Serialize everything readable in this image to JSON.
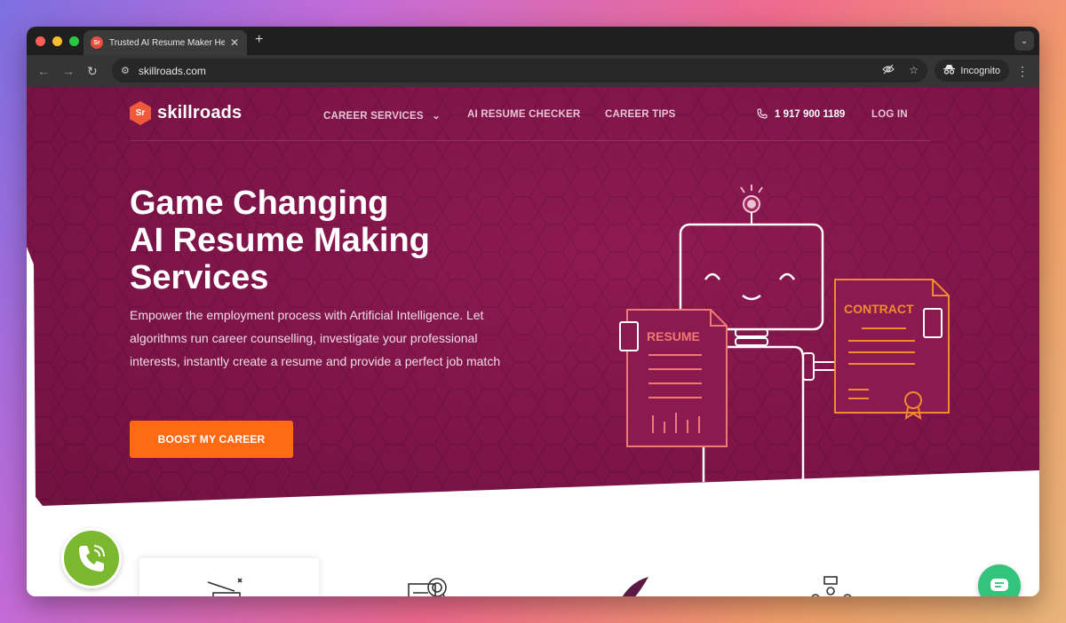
{
  "browser": {
    "tab_title": "Trusted AI Resume Maker Help",
    "tab_favicon_text": "Sr",
    "new_tab_label": "+",
    "url": "skillroads.com",
    "incognito_label": "Incognito"
  },
  "site": {
    "logo_mark": "Sr",
    "logo_text": "skillroads",
    "nav": {
      "career_services": "CAREER SERVICES",
      "ai_resume_checker": "AI RESUME CHECKER",
      "career_tips": "CAREER TIPS",
      "phone": "1 917 900 1189",
      "login": "LOG IN"
    },
    "hero": {
      "title_line1": "Game Changing",
      "title_line2": "AI Resume Making",
      "title_line3": "Services",
      "subtitle": "Empower the employment process with Artificial Intelligence. Let algorithms run career counselling, investigate your professional interests, instantly create a resume and provide a perfect job match",
      "cta_label": "BOOST MY CAREER"
    },
    "illustration": {
      "resume_label": "RESUME",
      "contract_label": "CONTRACT"
    },
    "services_icons": [
      "magic-hat-icon",
      "document-search-icon",
      "quill-pen-icon",
      "team-meeting-icon"
    ]
  },
  "colors": {
    "hero_bg": "#7d1448",
    "cta": "#ff6a13",
    "call_fab": "#7cb82f",
    "chat_fab": "#34c37b",
    "logo_accent": "#f05a3a"
  }
}
